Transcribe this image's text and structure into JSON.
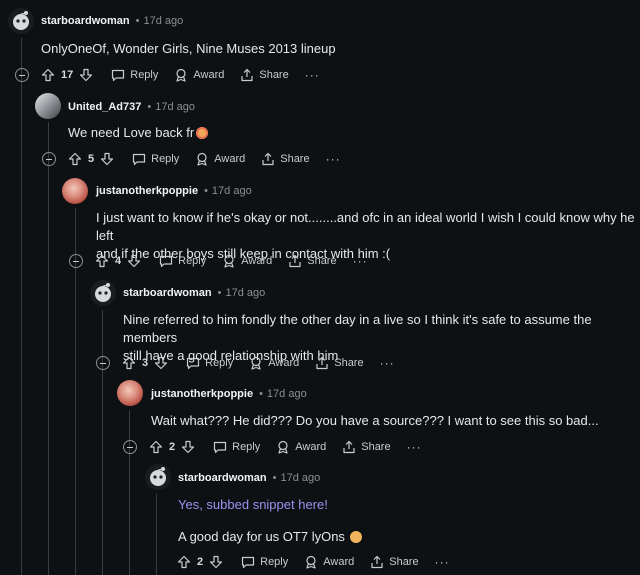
{
  "labels": {
    "reply": "Reply",
    "award": "Award",
    "share": "Share",
    "more": "···",
    "separator": "•"
  },
  "comments": [
    {
      "author": "starboardwoman",
      "time": "17d ago",
      "votes": "17",
      "body": [
        "OnlyOneOf, Wonder Girls, Nine Muses 2013 lineup"
      ]
    },
    {
      "author": "United_Ad737",
      "time": "17d ago",
      "votes": "5",
      "body": [
        "We need Love back fr"
      ]
    },
    {
      "author": "justanotherkpoppie",
      "time": "17d ago",
      "votes": "4",
      "body": [
        "I just want to know if he's okay or not........and ofc in an ideal world I wish I could know why he left",
        "and if the other boys still keep in contact with him :("
      ]
    },
    {
      "author": "starboardwoman",
      "time": "17d ago",
      "votes": "3",
      "body": [
        "Nine referred to him fondly the other day in a live so I think it's safe to assume the members",
        "still have a good relationship with him"
      ]
    },
    {
      "author": "justanotherkpoppie",
      "time": "17d ago",
      "votes": "2",
      "body": [
        "Wait what??? He did??? Do you have a source??? I want to see this so bad..."
      ]
    },
    {
      "author": "starboardwoman",
      "time": "17d ago",
      "votes": "2",
      "body": [
        "Yes, subbed snippet here!",
        "A good day for us OT7 lyOns"
      ]
    }
  ]
}
